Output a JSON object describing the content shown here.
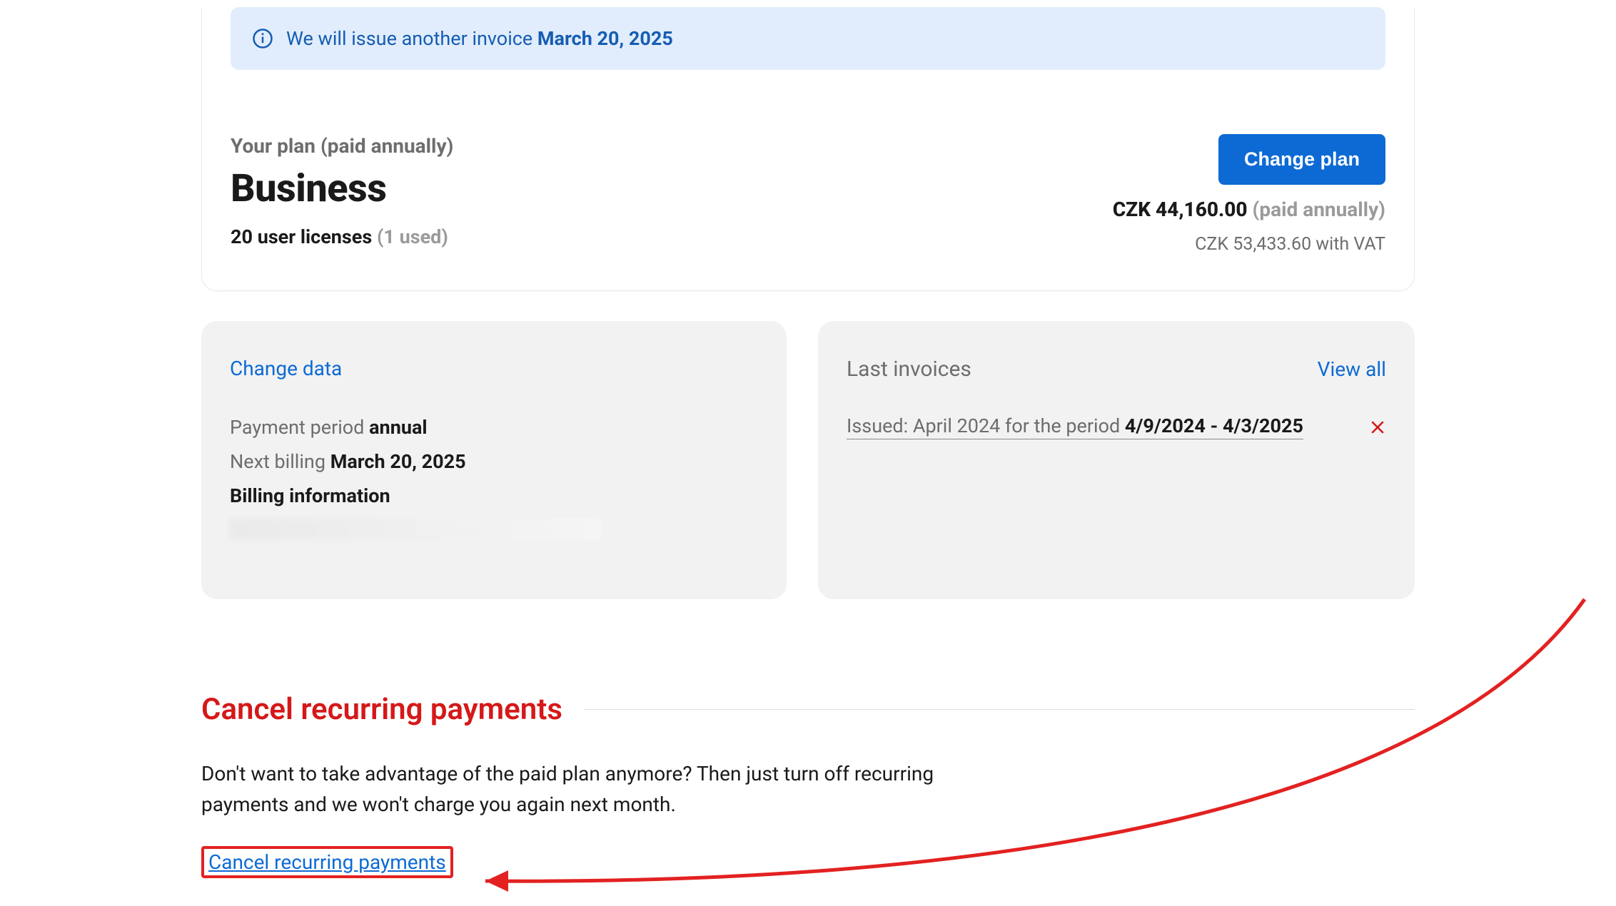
{
  "banner": {
    "text_prefix": "We will issue another invoice ",
    "date": "March 20, 2025"
  },
  "plan": {
    "label": "Your plan (paid annually)",
    "name": "Business",
    "licenses_count": "20 user licenses",
    "licenses_used": "(1 used)",
    "change_plan_btn": "Change plan",
    "price_amount": "CZK 44,160.00",
    "price_paid": "(paid annually)",
    "vat_line": "CZK 53,433.60 with VAT"
  },
  "billing_card": {
    "change_data": "Change data",
    "payment_period_label": "Payment period ",
    "payment_period_value": "annual",
    "next_billing_label": "Next billing ",
    "next_billing_value": "March 20, 2025",
    "billing_info_label": "Billing information"
  },
  "invoices_card": {
    "title": "Last invoices",
    "view_all": "View all",
    "invoice_prefix": "Issued: April 2024 for the period ",
    "invoice_range": "4/9/2024 - 4/3/2025"
  },
  "cancel": {
    "heading": "Cancel recurring payments",
    "text": "Don't want to take advantage of the paid plan anymore? Then just turn off recurring payments and we won't charge you again next month.",
    "link": "Cancel recurring payments"
  }
}
